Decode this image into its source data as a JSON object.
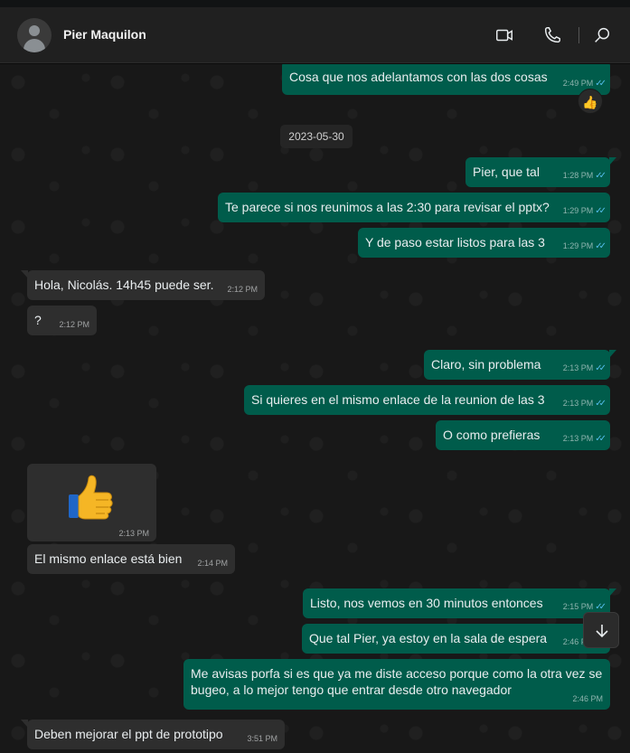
{
  "header": {
    "contact_name": "Pier Maquilon",
    "icons": [
      "video-call-icon",
      "voice-call-icon",
      "search-icon"
    ]
  },
  "date_separator": "2023-05-30",
  "reaction": "👍",
  "messages": [
    {
      "dir": "out",
      "text": "Cosa que nos adelantamos con las dos cosas",
      "time": "2:49 PM",
      "ticks": "✓✓"
    },
    {
      "dir": "out",
      "text": "Pier, que tal",
      "time": "1:28 PM",
      "ticks": "✓✓"
    },
    {
      "dir": "out",
      "text": "Te parece si nos reunimos a las 2:30 para revisar el pptx?",
      "time": "1:29 PM",
      "ticks": "✓✓"
    },
    {
      "dir": "out",
      "text": "Y de paso estar listos para las 3",
      "time": "1:29 PM",
      "ticks": "✓✓"
    },
    {
      "dir": "in",
      "text": "Hola, Nicolás. 14h45 puede ser.",
      "time": "2:12 PM"
    },
    {
      "dir": "in",
      "text": "?",
      "time": "2:12 PM"
    },
    {
      "dir": "out",
      "text": "Claro, sin problema",
      "time": "2:13 PM",
      "ticks": "✓✓"
    },
    {
      "dir": "out",
      "text": "Si quieres en el mismo enlace de la reunion de las 3",
      "time": "2:13 PM",
      "ticks": "✓✓"
    },
    {
      "dir": "out",
      "text": "O como prefieras",
      "time": "2:13 PM",
      "ticks": "✓✓"
    },
    {
      "dir": "in",
      "text": "👍",
      "time": "2:13 PM"
    },
    {
      "dir": "in",
      "text": "El mismo enlace está bien",
      "time": "2:14 PM"
    },
    {
      "dir": "out",
      "text": "Listo, nos vemos en 30 minutos entonces",
      "time": "2:15 PM",
      "ticks": "✓✓"
    },
    {
      "dir": "out",
      "text": "Que tal Pier, ya estoy en la sala de espera",
      "time": "2:46 PM",
      "ticks": "✓✓"
    },
    {
      "dir": "out",
      "text": "Me avisas porfa si es que ya me diste acceso porque como la otra vez se bugeo, a lo mejor tengo que entrar desde otro navegador",
      "time": "2:46 PM"
    },
    {
      "dir": "in",
      "text": "Deben mejorar el ppt de prototipo",
      "time": "3:51 PM"
    }
  ],
  "colors": {
    "outgoing_bubble": "#005c4b",
    "incoming_bubble": "#2e2e2e",
    "read_ticks": "#53bdeb",
    "chat_background": "#181818"
  }
}
